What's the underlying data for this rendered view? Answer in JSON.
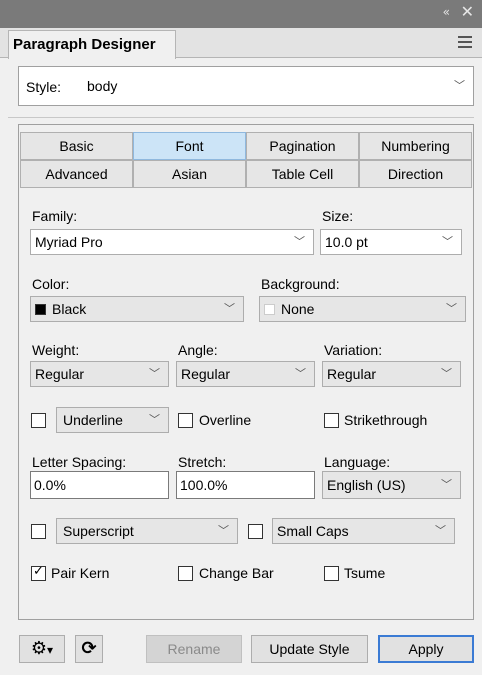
{
  "window": {
    "collapse_glyph": "«",
    "close_glyph": "✕"
  },
  "panel_tab": {
    "title": "Paragraph Designer"
  },
  "style_row": {
    "label": "Style:",
    "value": "body"
  },
  "tabs": [
    {
      "label": "Basic",
      "selected": false
    },
    {
      "label": "Font",
      "selected": true
    },
    {
      "label": "Pagination",
      "selected": false
    },
    {
      "label": "Numbering",
      "selected": false
    },
    {
      "label": "Advanced",
      "selected": false
    },
    {
      "label": "Asian",
      "selected": false
    },
    {
      "label": "Table Cell",
      "selected": false
    },
    {
      "label": "Direction",
      "selected": false
    }
  ],
  "font": {
    "family_label": "Family:",
    "family_value": "Myriad Pro",
    "size_label": "Size:",
    "size_value": "10.0 pt",
    "color_label": "Color:",
    "color_value": "Black",
    "color_swatch": "#000000",
    "background_label": "Background:",
    "background_value": "None",
    "background_swatch": "#ffffff",
    "weight_label": "Weight:",
    "weight_value": "Regular",
    "angle_label": "Angle:",
    "angle_value": "Regular",
    "variation_label": "Variation:",
    "variation_value": "Regular",
    "underline_value": "Underline",
    "underline_checked": false,
    "overline_label": "Overline",
    "overline_checked": false,
    "strikethrough_label": "Strikethrough",
    "strikethrough_checked": false,
    "letter_spacing_label": "Letter Spacing:",
    "letter_spacing_value": "0.0%",
    "stretch_label": "Stretch:",
    "stretch_value": "100.0%",
    "language_label": "Language:",
    "language_value": "English (US)",
    "superscript_value": "Superscript",
    "superscript_checked": false,
    "small_caps_value": "Small Caps",
    "small_caps_checked": false,
    "pair_kern_label": "Pair Kern",
    "pair_kern_checked": true,
    "change_bar_label": "Change Bar",
    "change_bar_checked": false,
    "tsume_label": "Tsume",
    "tsume_checked": false
  },
  "buttons": {
    "settings_glyph": "⚙",
    "dropdown_glyph": "▾",
    "refresh_glyph": "⟳",
    "rename": "Rename",
    "update_style": "Update Style",
    "apply": "Apply"
  }
}
